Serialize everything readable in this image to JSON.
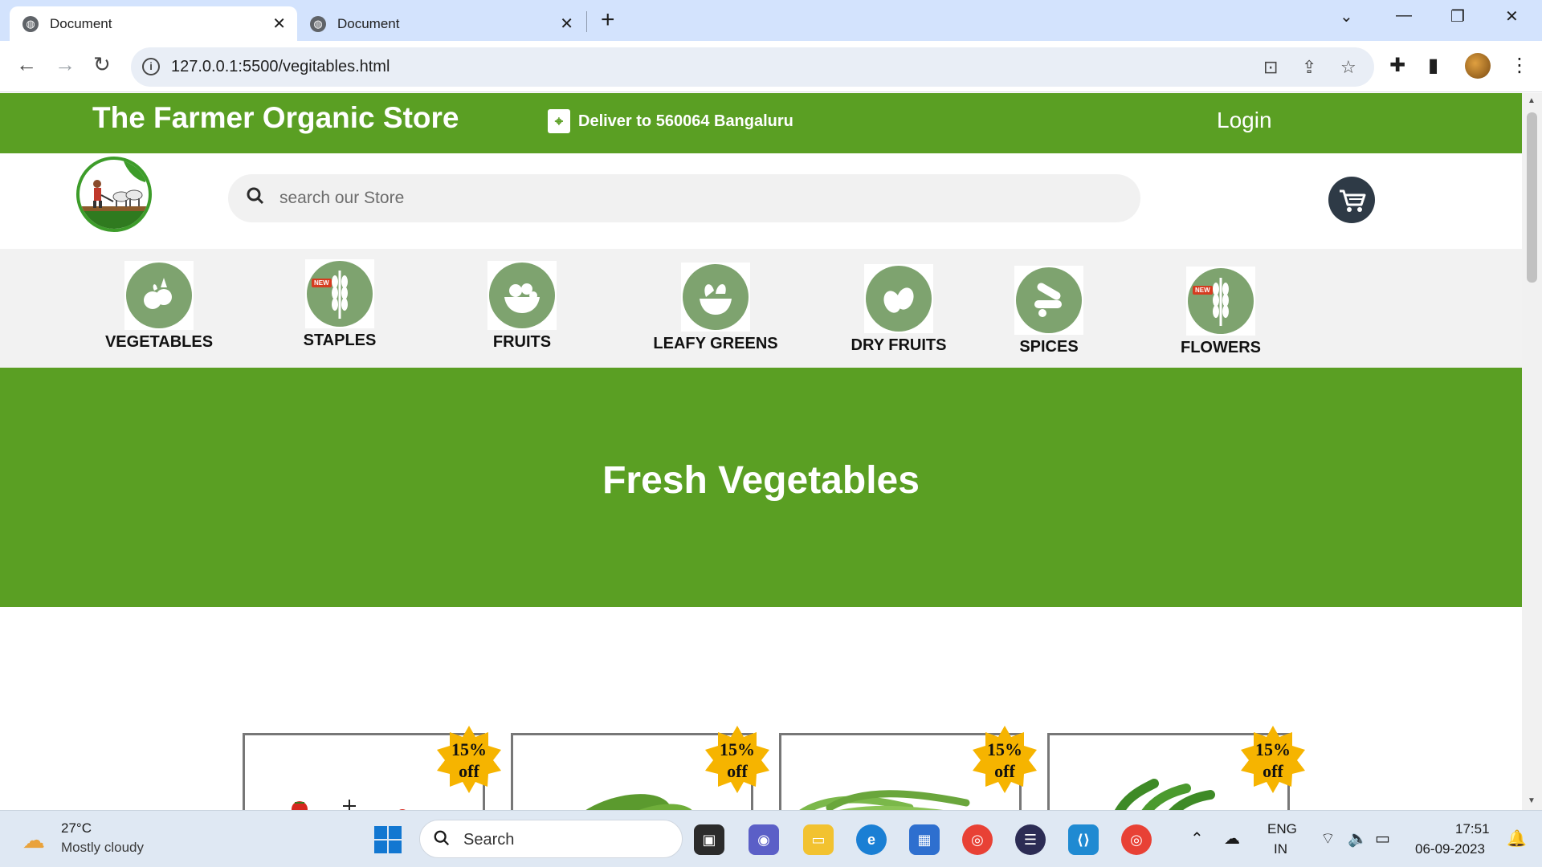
{
  "browser": {
    "tabs": [
      {
        "label": "Document",
        "active": true
      },
      {
        "label": "Document",
        "active": false
      }
    ],
    "url": "127.0.0.1:5500/vegitables.html"
  },
  "store": {
    "brand": "The Farmer Organic Store",
    "deliver": "Deliver to 560064 Bangaluru",
    "login": "Login",
    "search_placeholder": "search our Store",
    "accent_color": "#5a9f23"
  },
  "categories": [
    {
      "label": "VEGETABLES",
      "icon": "vegetables-basket-icon",
      "new": false
    },
    {
      "label": "STAPLES",
      "icon": "wheat-icon",
      "new": true
    },
    {
      "label": "FRUITS",
      "icon": "fruit-bowl-icon",
      "new": false
    },
    {
      "label": "LEAFY GREENS",
      "icon": "leafy-greens-icon",
      "new": false
    },
    {
      "label": "DRY FRUITS",
      "icon": "nuts-icon",
      "new": false
    },
    {
      "label": "SPICES",
      "icon": "spices-icon",
      "new": false
    },
    {
      "label": "FLOWERS",
      "icon": "wheat-icon",
      "new": true
    }
  ],
  "new_badge": "NEW",
  "hero": {
    "title": "Fresh Vegetables"
  },
  "products": [
    {
      "discount_pct": "15%",
      "discount_off": "off",
      "image": "tomato-image"
    },
    {
      "discount_pct": "15%",
      "discount_off": "off",
      "image": "cucumber-image"
    },
    {
      "discount_pct": "15%",
      "discount_off": "off",
      "image": "green-beans-image"
    },
    {
      "discount_pct": "15%",
      "discount_off": "off",
      "image": "green-chillies-image"
    }
  ],
  "taskbar": {
    "temp": "27°C",
    "weather": "Mostly cloudy",
    "search": "Search",
    "lang1": "ENG",
    "lang2": "IN",
    "time": "17:51",
    "date": "06-09-2023"
  }
}
